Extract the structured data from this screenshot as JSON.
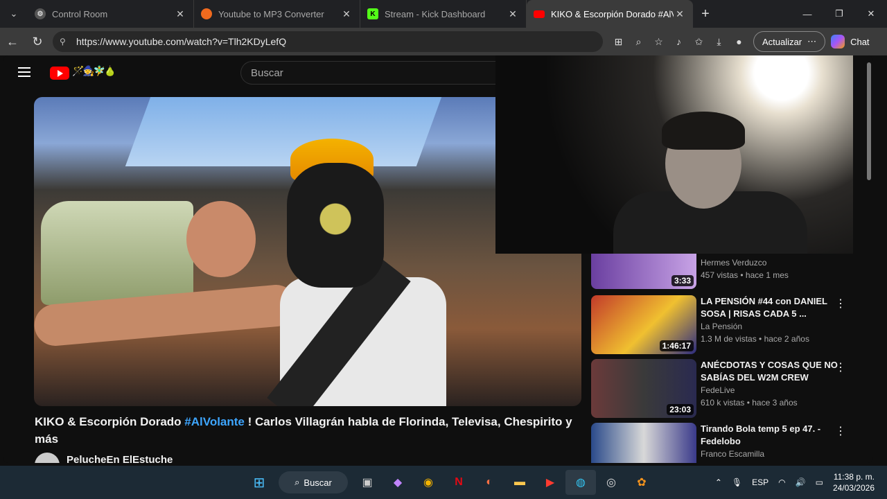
{
  "browser": {
    "tabs": [
      {
        "title": "Control Room",
        "icon": "steam-icon",
        "active": false
      },
      {
        "title": "Youtube to MP3 Converter",
        "icon": "converter-icon",
        "active": false
      },
      {
        "title": "Stream - Kick Dashboard",
        "icon": "kick-icon",
        "active": false
      },
      {
        "title": "KIKO & Escorpión Dorado #AlVola",
        "icon": "youtube-icon",
        "active": true
      }
    ],
    "url": "https://www.youtube.com/watch?v=Tlh2KDyLefQ",
    "update_label": "Actualizar",
    "chat_label": "Chat"
  },
  "youtube": {
    "search_placeholder": "Buscar",
    "video_title_pre": "KIKO & Escorpión Dorado ",
    "video_title_tag": "#AlVolante",
    "video_title_post": " ! Carlos Villagrán habla de Florinda, Televisa, Chespirito y más",
    "channel_name": "PelucheEn ElEstuche",
    "recommendations": [
      {
        "title": "",
        "channel": "Hermes Verduzco",
        "meta": "457 vistas • hace 1 mes",
        "duration": "3:33"
      },
      {
        "title": "LA PENSIÓN #44 con DANIEL SOSA | RISAS CADA 5 ...",
        "channel": "La Pensión",
        "meta": "1.3 M de vistas • hace 2 años",
        "duration": "1:46:17"
      },
      {
        "title": "ANÉCDOTAS Y COSAS QUE NO SABÍAS DEL W2M CREW",
        "channel": "FedeLive",
        "meta": "610 k vistas • hace 3 años",
        "duration": "23:03"
      },
      {
        "title": "Tirando Bola temp 5 ep 47. - Fedelobo",
        "channel": "Franco Escamilla",
        "meta": "",
        "duration": ""
      }
    ]
  },
  "taskbar": {
    "search_label": "Buscar",
    "lang": "ESP",
    "time": "11:38 p. m.",
    "date": "24/03/2026"
  }
}
